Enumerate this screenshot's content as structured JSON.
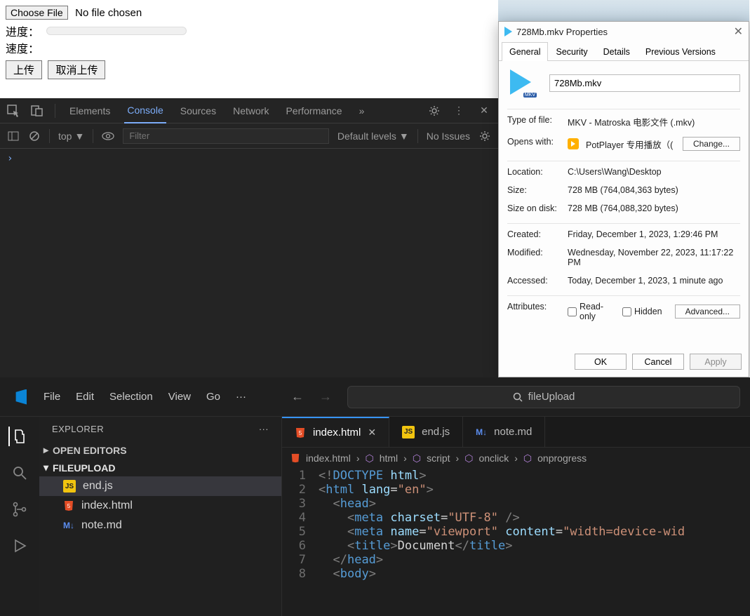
{
  "webpage": {
    "chooseFileLabel": "Choose File",
    "noFileText": "No file chosen",
    "progressLabel": "进度：",
    "speedLabel": "速度：",
    "uploadLabel": "上传",
    "cancelLabel": "取消上传"
  },
  "devtools": {
    "tabs": [
      "Elements",
      "Console",
      "Sources",
      "Network",
      "Performance"
    ],
    "activeTab": "Console",
    "moreIndicator": "»",
    "contextLabel": "top",
    "filterPlaceholder": "Filter",
    "levelsLabel": "Default levels",
    "issuesLabel": "No Issues",
    "consolePrompt": "›"
  },
  "properties": {
    "titlePrefix": "728Mb.mkv Properties",
    "tabs": [
      "General",
      "Security",
      "Details",
      "Previous Versions"
    ],
    "activeTab": "General",
    "filename": "728Mb.mkv",
    "rows": {
      "typeLabel": "Type of file:",
      "typeValue": "MKV - Matroska 电影文件 (.mkv)",
      "opensLabel": "Opens with:",
      "opensValue": "PotPlayer 专用播放（(",
      "changeLabel": "Change...",
      "locationLabel": "Location:",
      "locationValue": "C:\\Users\\Wang\\Desktop",
      "sizeLabel": "Size:",
      "sizeValue": "728 MB (764,084,363 bytes)",
      "sizeDiskLabel": "Size on disk:",
      "sizeDiskValue": "728 MB (764,088,320 bytes)",
      "createdLabel": "Created:",
      "createdValue": "Friday, December 1, 2023, 1:29:46 PM",
      "modifiedLabel": "Modified:",
      "modifiedValue": "Wednesday, November 22, 2023, 11:17:22 PM",
      "accessedLabel": "Accessed:",
      "accessedValue": "Today, December 1, 2023, 1 minute ago",
      "attributesLabel": "Attributes:",
      "readonlyLabel": "Read-only",
      "hiddenLabel": "Hidden",
      "advancedLabel": "Advanced..."
    },
    "buttons": {
      "ok": "OK",
      "cancel": "Cancel",
      "apply": "Apply"
    }
  },
  "vscode": {
    "menu": [
      "File",
      "Edit",
      "Selection",
      "View",
      "Go"
    ],
    "menuMore": "···",
    "searchLabel": "fileUpload",
    "explorer": {
      "title": "EXPLORER",
      "more": "···",
      "openEditors": "OPEN EDITORS",
      "folder": "FILEUPLOAD",
      "files": [
        "end.js",
        "index.html",
        "note.md"
      ]
    },
    "tabs": [
      {
        "label": "index.html",
        "icon": "html",
        "active": true,
        "closeable": true
      },
      {
        "label": "end.js",
        "icon": "js",
        "active": false
      },
      {
        "label": "note.md",
        "icon": "md",
        "active": false
      }
    ],
    "breadcrumb": [
      "index.html",
      "html",
      "script",
      "onclick",
      "onprogress"
    ],
    "code": [
      {
        "n": 1,
        "html": "<span class='c-punc'>&lt;!</span><span class='c-doc'>DOCTYPE</span> <span class='c-attr'>html</span><span class='c-punc'>&gt;</span>"
      },
      {
        "n": 2,
        "html": "<span class='c-punc'>&lt;</span><span class='c-tag'>html</span> <span class='c-attr'>lang</span><span class='c-white'>=</span><span class='c-str'>\"en\"</span><span class='c-punc'>&gt;</span>"
      },
      {
        "n": 3,
        "html": "  <span class='c-punc'>&lt;</span><span class='c-tag'>head</span><span class='c-punc'>&gt;</span>"
      },
      {
        "n": 4,
        "html": "    <span class='c-punc'>&lt;</span><span class='c-tag'>meta</span> <span class='c-attr'>charset</span><span class='c-white'>=</span><span class='c-str'>\"UTF-8\"</span> <span class='c-punc'>/&gt;</span>"
      },
      {
        "n": 5,
        "html": "    <span class='c-punc'>&lt;</span><span class='c-tag'>meta</span> <span class='c-attr'>name</span><span class='c-white'>=</span><span class='c-str'>\"viewport\"</span> <span class='c-attr'>content</span><span class='c-white'>=</span><span class='c-str'>\"width=device-wid</span>"
      },
      {
        "n": 6,
        "html": "    <span class='c-punc'>&lt;</span><span class='c-tag'>title</span><span class='c-punc'>&gt;</span><span class='c-white'>Document</span><span class='c-punc'>&lt;/</span><span class='c-tag'>title</span><span class='c-punc'>&gt;</span>"
      },
      {
        "n": 7,
        "html": "  <span class='c-punc'>&lt;/</span><span class='c-tag'>head</span><span class='c-punc'>&gt;</span>"
      },
      {
        "n": 8,
        "html": "  <span class='c-punc'>&lt;</span><span class='c-tag'>body</span><span class='c-punc'>&gt;</span>"
      }
    ]
  }
}
